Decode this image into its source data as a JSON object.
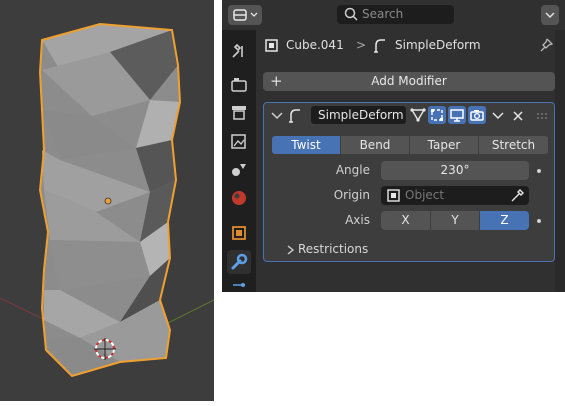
{
  "header": {
    "search_placeholder": "Search"
  },
  "breadcrumb": {
    "object": "Cube.041",
    "separator": ">",
    "modifier": "SimpleDeform"
  },
  "modifiers": {
    "add_label": "Add Modifier"
  },
  "panel": {
    "name": "SimpleDeform",
    "modes": [
      {
        "label": "Twist",
        "selected": true
      },
      {
        "label": "Bend",
        "selected": false
      },
      {
        "label": "Taper",
        "selected": false
      },
      {
        "label": "Stretch",
        "selected": false
      }
    ],
    "angle_label": "Angle",
    "angle_value": "230°",
    "origin_label": "Origin",
    "origin_placeholder": "Object",
    "axis_label": "Axis",
    "axes": [
      {
        "label": "X",
        "selected": false
      },
      {
        "label": "Y",
        "selected": false
      },
      {
        "label": "Z",
        "selected": true
      }
    ],
    "restrictions_label": "Restrictions"
  },
  "colors": {
    "accent": "#4772b3",
    "selection_outline": "#f0a030",
    "panel_bg": "#3d3d3d"
  }
}
